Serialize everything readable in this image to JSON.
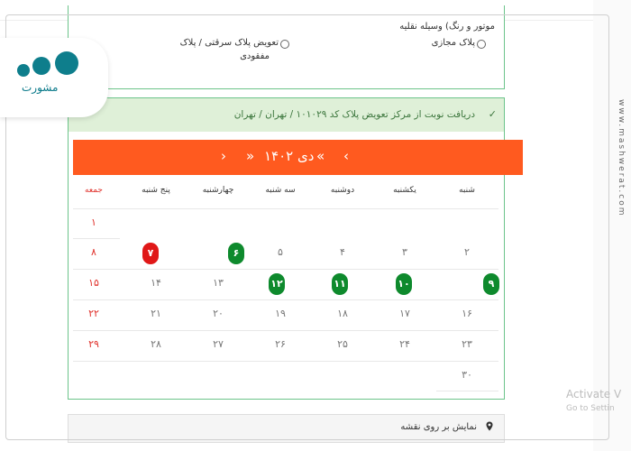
{
  "top_options": {
    "row1_label": "موتور و رنگ) وسیله نقلیه",
    "opt_virtual_plate": "پلاک مجازی",
    "opt_stolen_lost_line1": "تعویض پلاک سرقتی / پلاک",
    "opt_stolen_lost_line2": "مفقودی"
  },
  "appointment": {
    "title": "دریافت نوبت از مرکز تعویض پلاک کد ۱۰۱۰۲۹ / تهران / تهران",
    "check_icon": "check-icon"
  },
  "calendar": {
    "month_label": "دی ۱۴۰۲",
    "nav": {
      "prev_year": "«",
      "prev_month": "‹",
      "next_month": "›",
      "next_year": "»"
    },
    "header_color": "#ff5a1f",
    "weekdays": [
      "شنبه",
      "یکشنبه",
      "دوشنبه",
      "سه شنبه",
      "چهارشنبه",
      "پنج شنبه",
      "جمعه"
    ],
    "weeks": [
      [
        "",
        "",
        "",
        "",
        "",
        "",
        "۱"
      ],
      [
        "۲",
        "۳",
        "۴",
        "۵",
        "۶",
        "۷",
        "۸"
      ],
      [
        "۹",
        "۱۰",
        "۱۱",
        "۱۲",
        "۱۳",
        "۱۴",
        "۱۵"
      ],
      [
        "۱۶",
        "۱۷",
        "۱۸",
        "۱۹",
        "۲۰",
        "۲۱",
        "۲۲"
      ],
      [
        "۲۳",
        "۲۴",
        "۲۵",
        "۲۶",
        "۲۷",
        "۲۸",
        "۲۹"
      ],
      [
        "۳۰",
        "",
        "",
        "",
        "",
        "",
        ""
      ]
    ],
    "available_days": [
      "۶",
      "۹",
      "۱۰",
      "۱۱",
      "۱۲"
    ],
    "closed_days": [
      "۷"
    ],
    "available_color": "#0e8a2d",
    "closed_color": "#e01818",
    "friday_color": "#e0312b"
  },
  "map": {
    "label": "نمایش بر روی نقشه",
    "icon": "map-pin-icon"
  },
  "watermark": {
    "activate": "Activate V",
    "settings": "Go to Settin"
  },
  "brand": {
    "site": "www.mashwerat.com",
    "logo_text": "مشورت"
  }
}
